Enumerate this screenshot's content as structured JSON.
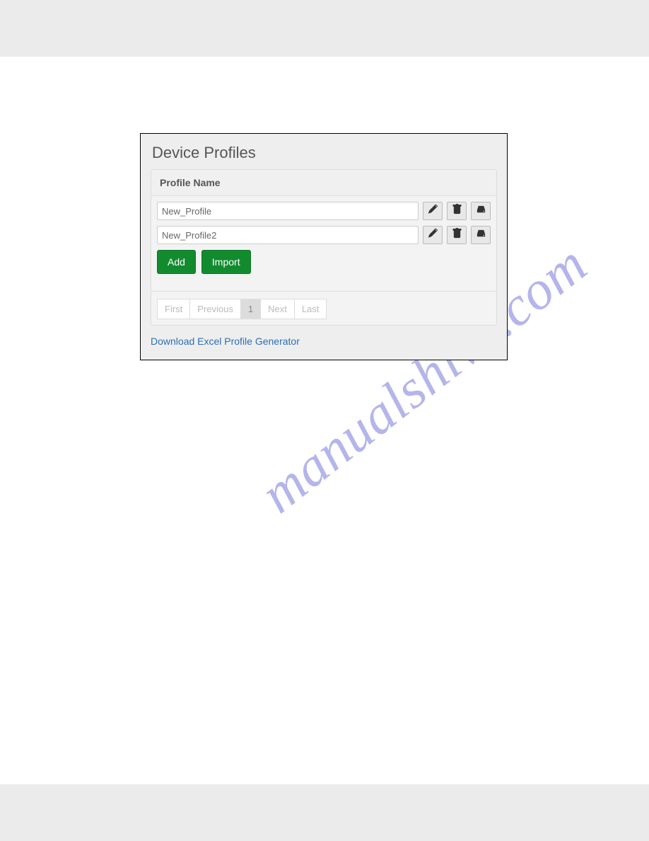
{
  "bands": {},
  "watermark": "manualshive.com",
  "panel": {
    "title": "Device Profiles",
    "column_header": "Profile Name",
    "rows": [
      {
        "name": "New_Profile"
      },
      {
        "name": "New_Profile2"
      }
    ],
    "buttons": {
      "add": "Add",
      "import": "Import"
    },
    "pagination": {
      "first": "First",
      "previous": "Previous",
      "page1": "1",
      "next": "Next",
      "last": "Last"
    },
    "download_link": "Download Excel Profile Generator"
  }
}
